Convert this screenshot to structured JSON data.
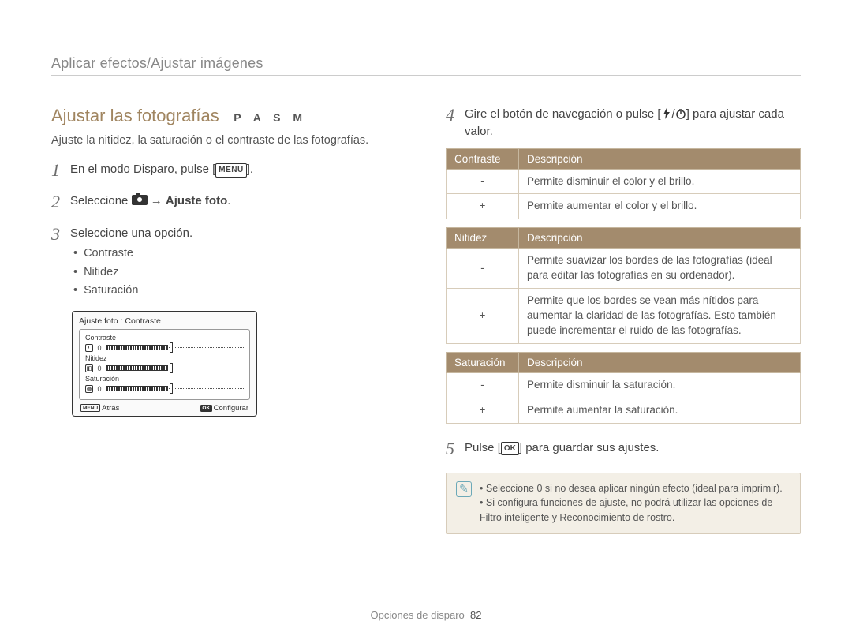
{
  "breadcrumb": "Aplicar efectos/Ajustar imágenes",
  "section_title": "Ajustar las fotografías",
  "pasm": "P A S M",
  "intro": "Ajuste la nitidez, la saturación o el contraste de las fotografías.",
  "steps_left": {
    "s1": {
      "num": "1",
      "pre": "En el modo Disparo, pulse [",
      "post": "]."
    },
    "s2": {
      "num": "2",
      "pre": "Seleccione ",
      "arrow": " → ",
      "bold": "Ajuste foto",
      "end": "."
    },
    "s3": {
      "num": "3",
      "text": "Seleccione una opción.",
      "bullets": [
        "Contraste",
        "Nitidez",
        "Saturación"
      ]
    }
  },
  "preview": {
    "title": "Ajuste foto : Contraste",
    "rows": [
      {
        "label": "Contraste",
        "zero": "0"
      },
      {
        "label": "Nitidez",
        "zero": "0"
      },
      {
        "label": "Saturación",
        "zero": "0"
      }
    ],
    "back": "Atrás",
    "set": "Configurar",
    "menu": "MENU",
    "ok": "OK"
  },
  "steps_right": {
    "s4": {
      "num": "4",
      "pre": "Gire el botón de navegación o pulse [",
      "mid": "/",
      "post": "] para ajustar cada valor."
    },
    "s5": {
      "num": "5",
      "pre": "Pulse [",
      "ok": "OK",
      "post": "] para guardar sus ajustes."
    }
  },
  "tables": {
    "t1": {
      "h1": "Contraste",
      "h2": "Descripción",
      "rows": [
        {
          "sym": "-",
          "desc": "Permite disminuir el color y el brillo."
        },
        {
          "sym": "+",
          "desc": "Permite aumentar el color y el brillo."
        }
      ]
    },
    "t2": {
      "h1": "Nitidez",
      "h2": "Descripción",
      "rows": [
        {
          "sym": "-",
          "desc": "Permite suavizar los bordes de las fotografías (ideal para editar las fotografías en su ordenador)."
        },
        {
          "sym": "+",
          "desc": "Permite que los bordes se vean más nítidos para aumentar la claridad de las fotografías. Esto también puede incrementar el ruido de las fotografías."
        }
      ]
    },
    "t3": {
      "h1": "Saturación",
      "h2": "Descripción",
      "rows": [
        {
          "sym": "-",
          "desc": "Permite disminuir la saturación."
        },
        {
          "sym": "+",
          "desc": "Permite aumentar la saturación."
        }
      ]
    }
  },
  "note": {
    "items": [
      "Seleccione 0 si no desea aplicar ningún efecto (ideal para imprimir).",
      "Si configura funciones de ajuste, no podrá utilizar las opciones de Filtro inteligente y Reconocimiento de rostro."
    ]
  },
  "footer": {
    "label": "Opciones de disparo",
    "page": "82"
  },
  "icons": {
    "menu": "MENU",
    "ok": "OK"
  }
}
